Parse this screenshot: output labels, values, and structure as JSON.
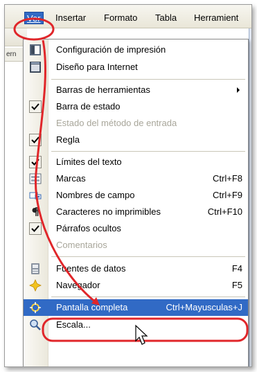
{
  "menubar": {
    "items": [
      {
        "label": "Ver",
        "active": true
      },
      {
        "label": "Insertar"
      },
      {
        "label": "Formato"
      },
      {
        "label": "Tabla"
      },
      {
        "label": "Herramient"
      }
    ]
  },
  "background": {
    "ruler_fragment": "ern"
  },
  "menu": {
    "items": [
      {
        "label": "Configuración de impresión",
        "icon": "print-layout-icon"
      },
      {
        "label": "Diseño para Internet",
        "icon": "web-layout-icon"
      },
      {
        "label": "Barras de herramientas",
        "submenu": true
      },
      {
        "label": "Barra de estado",
        "checked": true
      },
      {
        "label": "Estado del método de entrada",
        "disabled": true
      },
      {
        "label": "Regla",
        "checked": true
      },
      {
        "label": "Límites del texto",
        "checked": true
      },
      {
        "label": "Marcas",
        "shortcut": "Ctrl+F8",
        "icon": "field-shadings-icon"
      },
      {
        "label": "Nombres de campo",
        "shortcut": "Ctrl+F9",
        "icon": "field-names-icon"
      },
      {
        "label": "Caracteres no imprimibles",
        "shortcut": "Ctrl+F10",
        "icon": "pilcrow-icon"
      },
      {
        "label": "Párrafos ocultos",
        "checked": true
      },
      {
        "label": "Comentarios",
        "disabled": true
      },
      {
        "label": "Fuentes de datos",
        "shortcut": "F4",
        "icon": "data-sources-icon"
      },
      {
        "label": "Navegador",
        "shortcut": "F5",
        "icon": "navigator-icon"
      },
      {
        "label": "Pantalla completa",
        "shortcut": "Ctrl+Mayusculas+J",
        "icon": "full-screen-icon",
        "highlighted": true
      },
      {
        "label": "Escala...",
        "icon": "zoom-icon"
      }
    ]
  },
  "colors": {
    "highlight": "#316ac5",
    "annotation": "#e0262a"
  }
}
